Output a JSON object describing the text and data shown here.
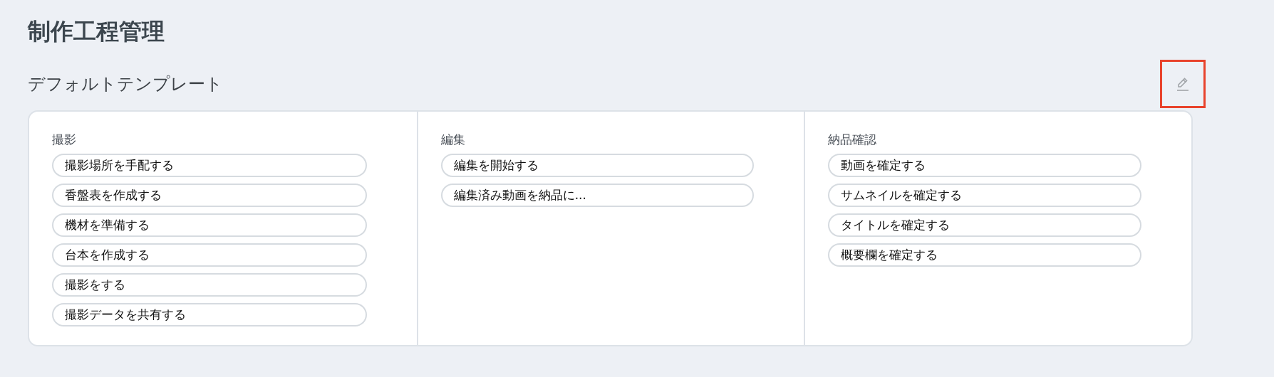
{
  "page": {
    "title": "制作工程管理"
  },
  "template": {
    "name": "デフォルトテンプレート",
    "edit_button": {
      "highlighted": true
    },
    "stages": [
      {
        "name": "撮影",
        "tasks": [
          "撮影場所を手配する",
          "香盤表を作成する",
          "機材を準備する",
          "台本を作成する",
          "撮影をする",
          "撮影データを共有する"
        ]
      },
      {
        "name": "編集",
        "tasks": [
          "編集を開始する",
          "編集済み動画を納品に..."
        ]
      },
      {
        "name": "納品確認",
        "tasks": [
          "動画を確定する",
          "サムネイルを確定する",
          "タイトルを確定する",
          "概要欄を確定する"
        ]
      }
    ]
  }
}
